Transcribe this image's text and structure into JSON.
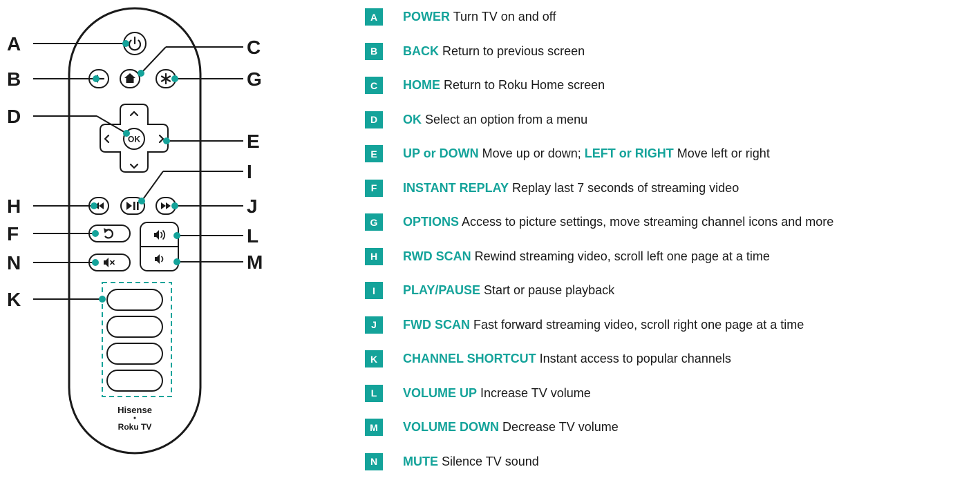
{
  "colors": {
    "accent": "#14a39a",
    "ink": "#1a1a1a",
    "background": "#ffffff"
  },
  "remote": {
    "brand": "Hisense",
    "brand_sub": "Roku TV",
    "ok_label": "OK",
    "icons": {
      "A": "power-icon",
      "B": "back-arrow-icon",
      "C": "home-icon",
      "G": "asterisk-icon",
      "D": "ok-button",
      "E": "dpad-arrows",
      "H": "rewind-icon",
      "I": "play-pause-icon",
      "J": "fast-forward-icon",
      "F": "instant-replay-icon",
      "L": "volume-up-icon",
      "M": "volume-down-icon",
      "N": "mute-icon",
      "K": "shortcut-buttons"
    }
  },
  "callouts": {
    "A": "A",
    "B": "B",
    "C": "C",
    "D": "D",
    "E": "E",
    "F": "F",
    "G": "G",
    "H": "H",
    "I": "I",
    "J": "J",
    "K": "K",
    "L": "L",
    "M": "M",
    "N": "N"
  },
  "legend": [
    {
      "letter": "A",
      "segments": [
        {
          "term": "POWER"
        },
        {
          "text": " Turn TV on and off"
        }
      ]
    },
    {
      "letter": "B",
      "segments": [
        {
          "term": "BACK"
        },
        {
          "text": " Return to previous screen"
        }
      ]
    },
    {
      "letter": "C",
      "segments": [
        {
          "term": "HOME"
        },
        {
          "text": " Return to Roku Home screen"
        }
      ]
    },
    {
      "letter": "D",
      "segments": [
        {
          "term": "OK"
        },
        {
          "text": " Select an option from a menu"
        }
      ]
    },
    {
      "letter": "E",
      "segments": [
        {
          "term": "UP or DOWN"
        },
        {
          "text": " Move up or down; "
        },
        {
          "term": "LEFT or RIGHT"
        },
        {
          "text": " Move left or right"
        }
      ]
    },
    {
      "letter": "F",
      "segments": [
        {
          "term": "INSTANT REPLAY"
        },
        {
          "text": " Replay last 7 seconds of streaming video"
        }
      ]
    },
    {
      "letter": "G",
      "segments": [
        {
          "term": "OPTIONS"
        },
        {
          "text": " Access to picture settings, move streaming channel icons and more"
        }
      ]
    },
    {
      "letter": "H",
      "segments": [
        {
          "term": "RWD SCAN"
        },
        {
          "text": " Rewind streaming video, scroll left one page at a time"
        }
      ]
    },
    {
      "letter": "I",
      "segments": [
        {
          "term": "PLAY/PAUSE"
        },
        {
          "text": " Start or pause playback"
        }
      ]
    },
    {
      "letter": "J",
      "segments": [
        {
          "term": "FWD SCAN"
        },
        {
          "text": " Fast forward streaming video, scroll right one page at a time"
        }
      ]
    },
    {
      "letter": "K",
      "segments": [
        {
          "term": "CHANNEL SHORTCUT"
        },
        {
          "text": " Instant access to popular channels"
        }
      ]
    },
    {
      "letter": "L",
      "segments": [
        {
          "term": "VOLUME UP"
        },
        {
          "text": " Increase TV volume"
        }
      ]
    },
    {
      "letter": "M",
      "segments": [
        {
          "term": "VOLUME DOWN"
        },
        {
          "text": " Decrease TV volume"
        }
      ]
    },
    {
      "letter": "N",
      "segments": [
        {
          "term": "MUTE"
        },
        {
          "text": " Silence TV sound"
        }
      ]
    }
  ]
}
